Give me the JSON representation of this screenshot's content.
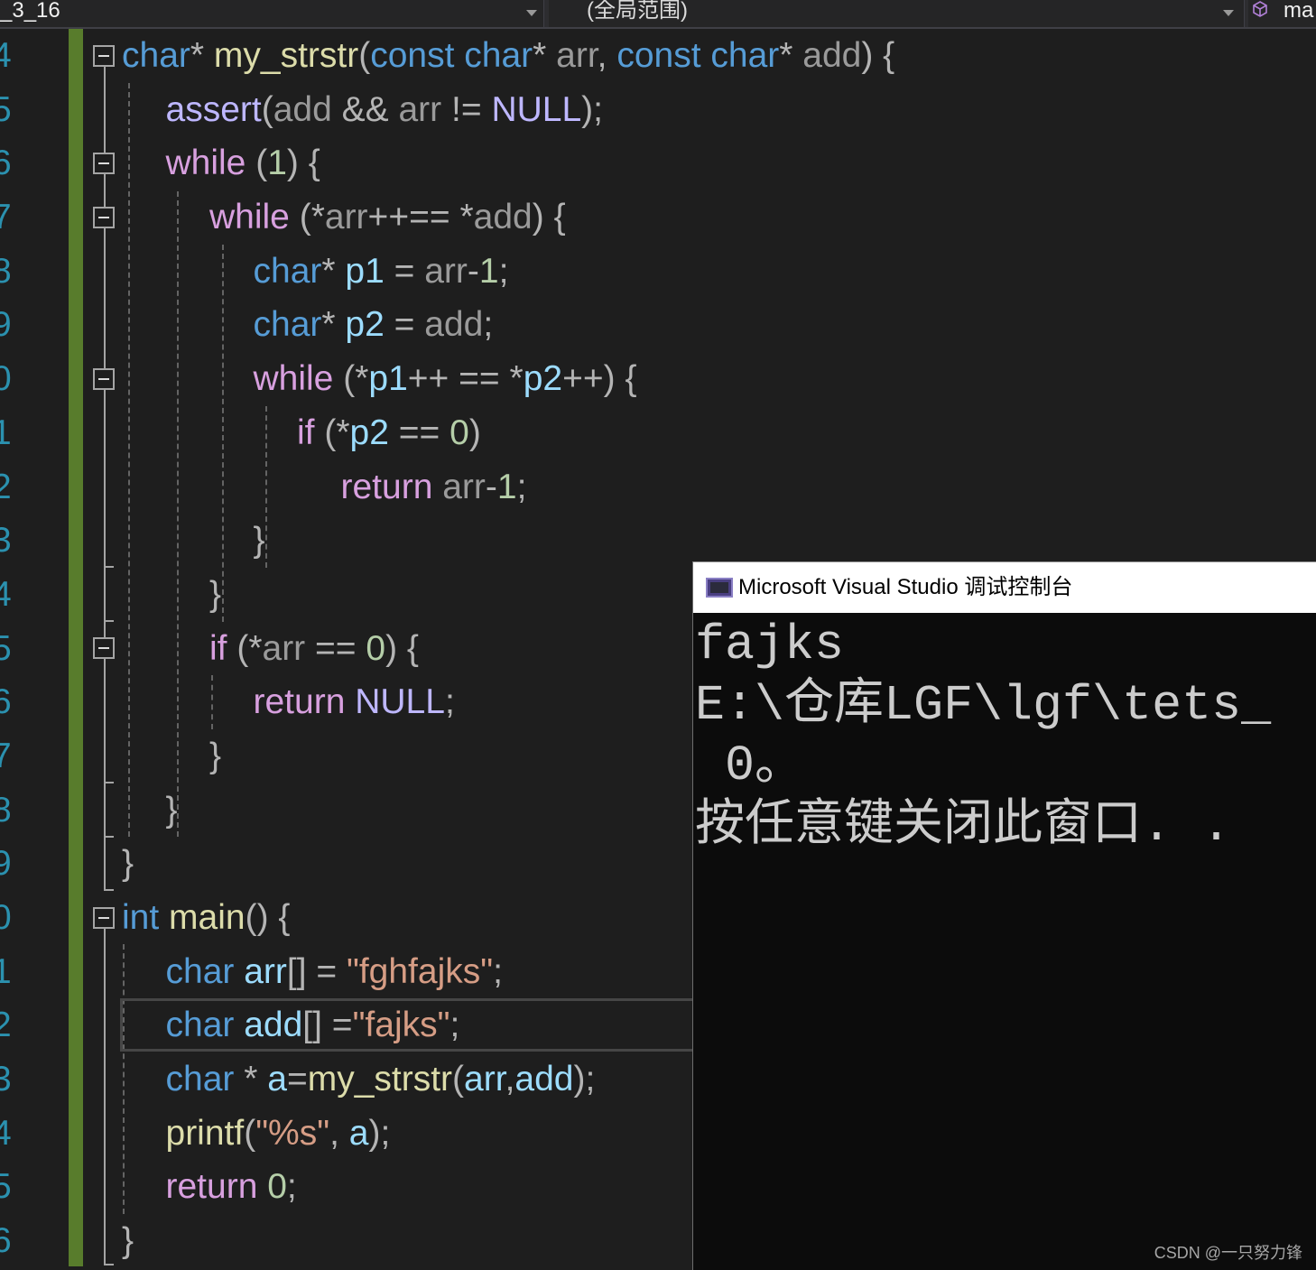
{
  "navigation_bar": {
    "file_dropdown": {
      "label": "_3_16",
      "icon": "chevron-down-icon"
    },
    "scope_dropdown": {
      "label": "(全局范围)",
      "icon": "chevron-down-icon"
    },
    "member_dropdown": {
      "label": "ma",
      "icon": "cube-icon"
    }
  },
  "colors": {
    "editor_background": "#1e1e1e",
    "line_number": "#2b91af",
    "change_bar": "#587c2c",
    "console_title_background": "#ffffff",
    "console_background": "#0c0c0c",
    "console_text": "#cccccc"
  },
  "editor": {
    "line_numbers": [
      "4",
      "5",
      "6",
      "7",
      "8",
      "9",
      "0",
      "1",
      "2",
      "3",
      "4",
      "5",
      "6",
      "7",
      "8",
      "9",
      "0",
      "1",
      "2",
      "3",
      "4",
      "5",
      "6"
    ],
    "lines": [
      [
        [
          "#569cd6",
          "char"
        ],
        [
          "#b4b4b4",
          "* "
        ],
        [
          "#dcdcaa",
          "my_strstr"
        ],
        [
          "#b4b4b4",
          "("
        ],
        [
          "#569cd6",
          "const char"
        ],
        [
          "#b4b4b4",
          "* "
        ],
        [
          "#9a9a9a",
          "arr"
        ],
        [
          "#b4b4b4",
          ", "
        ],
        [
          "#569cd6",
          "const char"
        ],
        [
          "#b4b4b4",
          "* "
        ],
        [
          "#9a9a9a",
          "add"
        ],
        [
          "#b4b4b4",
          ") {"
        ]
      ],
      [
        [
          "#beb7ff",
          "assert"
        ],
        [
          "#b4b4b4",
          "("
        ],
        [
          "#9a9a9a",
          "add"
        ],
        [
          "#b4b4b4",
          " && "
        ],
        [
          "#9a9a9a",
          "arr"
        ],
        [
          "#b4b4b4",
          " != "
        ],
        [
          "#beb7ff",
          "NULL"
        ],
        [
          "#b4b4b4",
          ");"
        ]
      ],
      [
        [
          "#d8a0df",
          "while"
        ],
        [
          "#b4b4b4",
          " ("
        ],
        [
          "#b5cea8",
          "1"
        ],
        [
          "#b4b4b4",
          ") {"
        ]
      ],
      [
        [
          "#d8a0df",
          "while"
        ],
        [
          "#b4b4b4",
          " (*"
        ],
        [
          "#9a9a9a",
          "arr"
        ],
        [
          "#b4b4b4",
          "++== *"
        ],
        [
          "#9a9a9a",
          "add"
        ],
        [
          "#b4b4b4",
          ") {"
        ]
      ],
      [
        [
          "#569cd6",
          "char"
        ],
        [
          "#b4b4b4",
          "* "
        ],
        [
          "#9cdcfe",
          "p1"
        ],
        [
          "#b4b4b4",
          " = "
        ],
        [
          "#9a9a9a",
          "arr"
        ],
        [
          "#b4b4b4",
          "-"
        ],
        [
          "#b5cea8",
          "1"
        ],
        [
          "#b4b4b4",
          ";"
        ]
      ],
      [
        [
          "#569cd6",
          "char"
        ],
        [
          "#b4b4b4",
          "* "
        ],
        [
          "#9cdcfe",
          "p2"
        ],
        [
          "#b4b4b4",
          " = "
        ],
        [
          "#9a9a9a",
          "add"
        ],
        [
          "#b4b4b4",
          ";"
        ]
      ],
      [
        [
          "#d8a0df",
          "while"
        ],
        [
          "#b4b4b4",
          " (*"
        ],
        [
          "#9cdcfe",
          "p1"
        ],
        [
          "#b4b4b4",
          "++ == *"
        ],
        [
          "#9cdcfe",
          "p2"
        ],
        [
          "#b4b4b4",
          "++) {"
        ]
      ],
      [
        [
          "#d8a0df",
          "if"
        ],
        [
          "#b4b4b4",
          " (*"
        ],
        [
          "#9cdcfe",
          "p2"
        ],
        [
          "#b4b4b4",
          " == "
        ],
        [
          "#b5cea8",
          "0"
        ],
        [
          "#b4b4b4",
          ")"
        ]
      ],
      [
        [
          "#d8a0df",
          "return "
        ],
        [
          "#9a9a9a",
          "arr"
        ],
        [
          "#b4b4b4",
          "-"
        ],
        [
          "#b5cea8",
          "1"
        ],
        [
          "#b4b4b4",
          ";"
        ]
      ],
      [
        [
          "#b4b4b4",
          "}"
        ]
      ],
      [
        [
          "#b4b4b4",
          "}"
        ]
      ],
      [
        [
          "#d8a0df",
          "if"
        ],
        [
          "#b4b4b4",
          " (*"
        ],
        [
          "#9a9a9a",
          "arr"
        ],
        [
          "#b4b4b4",
          " == "
        ],
        [
          "#b5cea8",
          "0"
        ],
        [
          "#b4b4b4",
          ") {"
        ]
      ],
      [
        [
          "#d8a0df",
          "return "
        ],
        [
          "#beb7ff",
          "NULL"
        ],
        [
          "#b4b4b4",
          ";"
        ]
      ],
      [
        [
          "#b4b4b4",
          "}"
        ]
      ],
      [
        [
          "#b4b4b4",
          "}"
        ]
      ],
      [
        [
          "#b4b4b4",
          "}"
        ]
      ],
      [
        [
          "#569cd6",
          "int "
        ],
        [
          "#dcdcaa",
          "main"
        ],
        [
          "#b4b4b4",
          "() {"
        ]
      ],
      [
        [
          "#569cd6",
          "char "
        ],
        [
          "#9cdcfe",
          "arr"
        ],
        [
          "#b4b4b4",
          "[] = "
        ],
        [
          "#d69d85",
          "\"fghfajks\""
        ],
        [
          "#b4b4b4",
          ";"
        ]
      ],
      [
        [
          "#569cd6",
          "char "
        ],
        [
          "#9cdcfe",
          "add"
        ],
        [
          "#b4b4b4",
          "[] ="
        ],
        [
          "#d69d85",
          "\"fajks\""
        ],
        [
          "#b4b4b4",
          ";"
        ]
      ],
      [
        [
          "#569cd6",
          "char"
        ],
        [
          "#b4b4b4",
          " * "
        ],
        [
          "#9cdcfe",
          "a"
        ],
        [
          "#b4b4b4",
          "="
        ],
        [
          "#dcdcaa",
          "my_strstr"
        ],
        [
          "#b4b4b4",
          "("
        ],
        [
          "#9cdcfe",
          "arr"
        ],
        [
          "#b4b4b4",
          ","
        ],
        [
          "#9cdcfe",
          "add"
        ],
        [
          "#b4b4b4",
          ");"
        ]
      ],
      [
        [
          "#dcdcaa",
          "printf"
        ],
        [
          "#b4b4b4",
          "("
        ],
        [
          "#d69d85",
          "\"%s\""
        ],
        [
          "#b4b4b4",
          ", "
        ],
        [
          "#9cdcfe",
          "a"
        ],
        [
          "#b4b4b4",
          ");"
        ]
      ],
      [
        [
          "#d8a0df",
          "return "
        ],
        [
          "#b5cea8",
          "0"
        ],
        [
          "#b4b4b4",
          ";"
        ]
      ],
      [
        [
          "#b4b4b4",
          "}"
        ]
      ]
    ]
  },
  "console": {
    "title": "Microsoft Visual Studio 调试控制台",
    "output": [
      "fajks",
      "E:\\仓库LGF\\lgf\\tets_",
      " 0。",
      "按任意键关闭此窗口. ."
    ]
  },
  "watermark": "CSDN @一只努力锋"
}
